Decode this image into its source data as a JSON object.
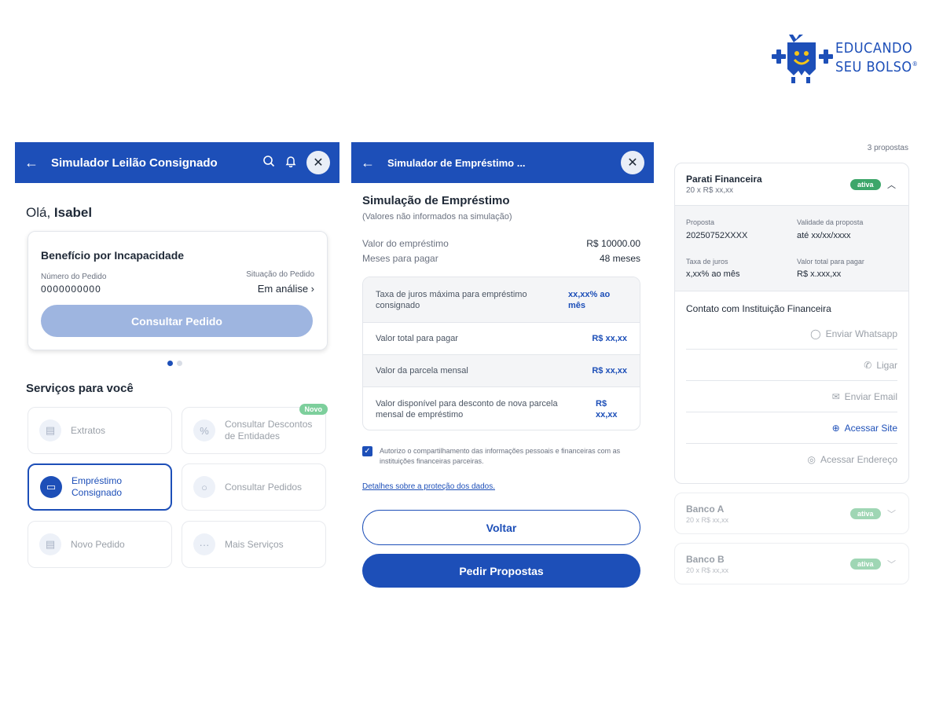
{
  "logo": {
    "line1": "EDUCANDO",
    "line2": "SEU BOLSO",
    "reg": "®"
  },
  "panel1": {
    "appbar_title": "Simulador Leilão Consignado",
    "greeting_prefix": "Olá, ",
    "greeting_name": "Isabel",
    "card": {
      "title": "Benefício por Incapacidade",
      "order_label": "Número do Pedido",
      "order_value": "0000000000",
      "status_label": "Situação do Pedido",
      "status_value": "Em análise ›",
      "button": "Consultar Pedido"
    },
    "services_title": "Serviços para você",
    "services": [
      {
        "label": "Extratos"
      },
      {
        "label": "Consultar Descontos de Entidades",
        "badge": "Novo"
      },
      {
        "label": "Empréstimo Consignado"
      },
      {
        "label": "Consultar Pedidos"
      },
      {
        "label": "Novo Pedido"
      },
      {
        "label": "Mais Serviços"
      }
    ]
  },
  "panel2": {
    "appbar_title": "Simulador de Empréstimo ...",
    "title": "Simulação de Empréstimo",
    "subtitle": "(Valores não informados na simulação)",
    "loan_label": "Valor do empréstimo",
    "loan_value": "R$ 10000.00",
    "months_label": "Meses para pagar",
    "months_value": "48 meses",
    "rows": [
      {
        "label": "Taxa de juros máxima para empréstimo consignado",
        "value": "xx,xx% ao mês"
      },
      {
        "label": "Valor total para pagar",
        "value": "R$ xx,xx"
      },
      {
        "label": "Valor da parcela mensal",
        "value": "R$ xx,xx"
      },
      {
        "label": "Valor disponível para desconto de nova parcela mensal de empréstimo",
        "value": "R$ xx,xx"
      }
    ],
    "consent": "Autorizo o compartilhamento das informações pessoais e financeiras com as instituições financeiras parceiras.",
    "data_link": "Detalhes sobre a proteção dos dados.",
    "back_button": "Voltar",
    "request_button": "Pedir Propostas"
  },
  "panel3": {
    "count": "3 propostas",
    "main": {
      "name": "Parati Financeira",
      "sub": "20 x R$ xx,xx",
      "status": "ativa",
      "proposal_label": "Proposta",
      "proposal_value": "20250752XXXX",
      "validity_label": "Validade da proposta",
      "validity_value": "até xx/xx/xxxx",
      "rate_label": "Taxa de juros",
      "rate_value": "x,xx% ao mês",
      "total_label": "Valor total para pagar",
      "total_value": "R$ x.xxx,xx",
      "contact_title": "Contato com Instituição Financeira",
      "contacts": [
        {
          "label": "Enviar Whatsapp",
          "icon": "chat-icon"
        },
        {
          "label": "Ligar",
          "icon": "phone-icon"
        },
        {
          "label": "Enviar Email",
          "icon": "mail-icon"
        },
        {
          "label": "Acessar Site",
          "icon": "globe-icon"
        },
        {
          "label": "Acessar Endereço",
          "icon": "location-icon"
        }
      ]
    },
    "others": [
      {
        "name": "Banco A",
        "sub": "20 x R$ xx,xx",
        "status": "ativa"
      },
      {
        "name": "Banco B",
        "sub": "20 x R$ xx,xx",
        "status": "ativa"
      }
    ]
  },
  "colors": {
    "primary": "#1d4fb8",
    "success": "#3da66a",
    "badge_new": "#7dcf9c",
    "disabled": "#9eb5e0"
  }
}
